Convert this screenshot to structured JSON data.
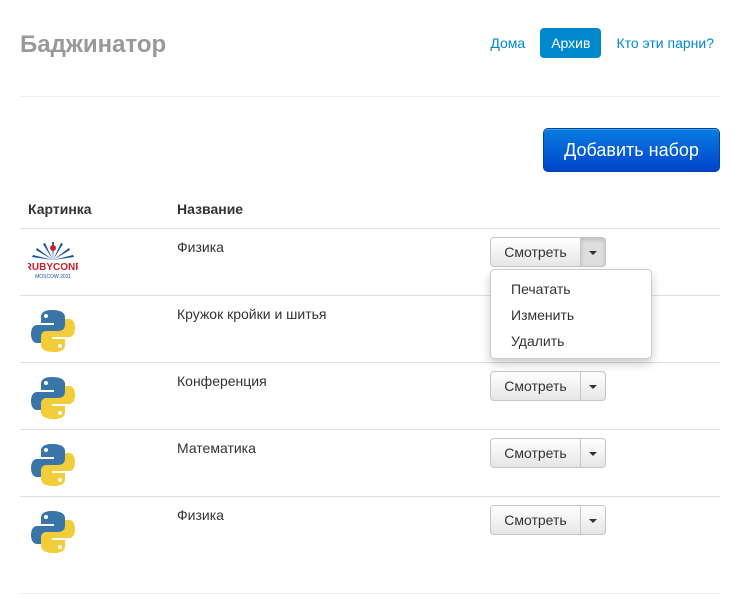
{
  "brand": "Баджинатор",
  "nav": {
    "home": "Дома",
    "archive": "Архив",
    "about": "Кто эти парни?"
  },
  "actions": {
    "add_set": "Добавить набор"
  },
  "table": {
    "headers": {
      "picture": "Картинка",
      "name": "Название"
    },
    "rows": [
      {
        "name": "Физика",
        "image": "rubyconf-logo",
        "image_text": "RUBYCONF",
        "image_subtext": "MOSCOW 2011"
      },
      {
        "name": "Кружок кройки и шитья",
        "image": "python-logo"
      },
      {
        "name": "Конференция",
        "image": "python-logo"
      },
      {
        "name": "Математика",
        "image": "python-logo"
      },
      {
        "name": "Физика",
        "image": "python-logo"
      }
    ],
    "view_label": "Смотреть"
  },
  "dropdown": {
    "items": [
      "Печатать",
      "Изменить",
      "Удалить"
    ]
  },
  "colors": {
    "accent": "#0088cc",
    "python_blue": "#3a75a8",
    "python_yellow": "#f2cd39",
    "rubyconf_red": "#c8202e",
    "rubyconf_blue": "#1b4fa0"
  }
}
